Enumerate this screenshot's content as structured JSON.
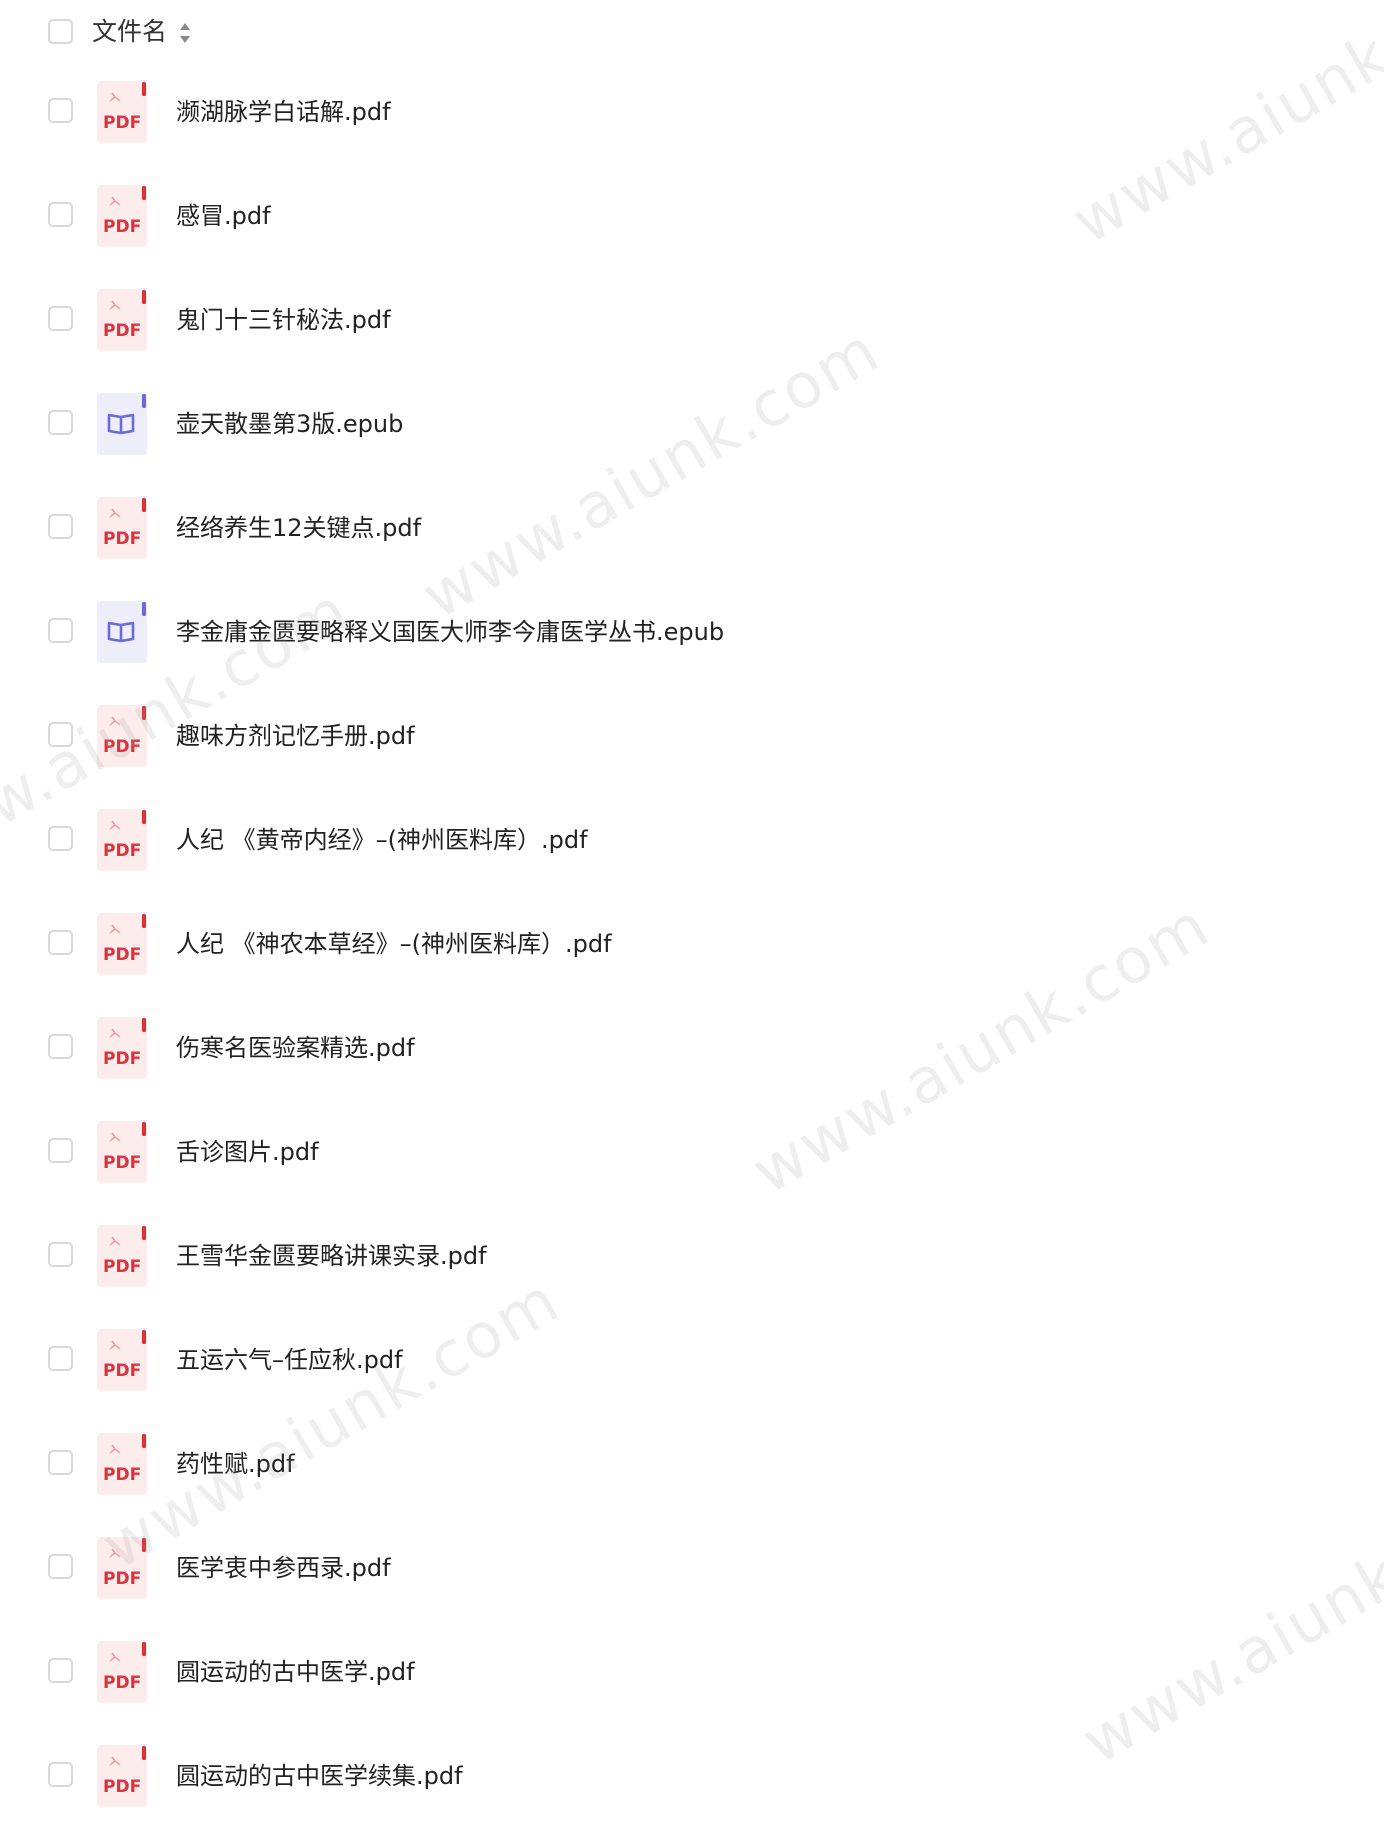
{
  "header": {
    "label": "文件名",
    "sort_icon": "sort-updown-icon"
  },
  "files": [
    {
      "name": "濒湖脉学白话解.pdf",
      "type": "pdf"
    },
    {
      "name": "感冒.pdf",
      "type": "pdf"
    },
    {
      "name": "鬼门十三针秘法.pdf",
      "type": "pdf"
    },
    {
      "name": "壶天散墨第3版.epub",
      "type": "epub"
    },
    {
      "name": "经络养生12关键点.pdf",
      "type": "pdf"
    },
    {
      "name": "李金庸金匮要略释义国医大师李今庸医学丛书.epub",
      "type": "epub"
    },
    {
      "name": "趣味方剂记忆手册.pdf",
      "type": "pdf"
    },
    {
      "name": "人纪 《黄帝内经》–(神州医料库）.pdf",
      "type": "pdf"
    },
    {
      "name": "人纪 《神农本草经》–(神州医料库）.pdf",
      "type": "pdf"
    },
    {
      "name": "伤寒名医验案精选.pdf",
      "type": "pdf"
    },
    {
      "name": "舌诊图片.pdf",
      "type": "pdf"
    },
    {
      "name": "王雪华金匮要略讲课实录.pdf",
      "type": "pdf"
    },
    {
      "name": "五运六气–任应秋.pdf",
      "type": "pdf"
    },
    {
      "name": "药性赋.pdf",
      "type": "pdf"
    },
    {
      "name": "医学衷中参西录.pdf",
      "type": "pdf"
    },
    {
      "name": "圆运动的古中医学.pdf",
      "type": "pdf"
    },
    {
      "name": "圆运动的古中医学续集.pdf",
      "type": "pdf"
    }
  ],
  "icons": {
    "pdf": {
      "name": "pdf-file-icon",
      "label": "PDF",
      "bg": "#fdecec",
      "accent": "#e0313b"
    },
    "epub": {
      "name": "epub-file-icon",
      "bg": "#eeeefb",
      "accent": "#6b6cd8"
    }
  },
  "watermark": {
    "text": "www.aiunk.com",
    "color": "#9a9a9a"
  }
}
